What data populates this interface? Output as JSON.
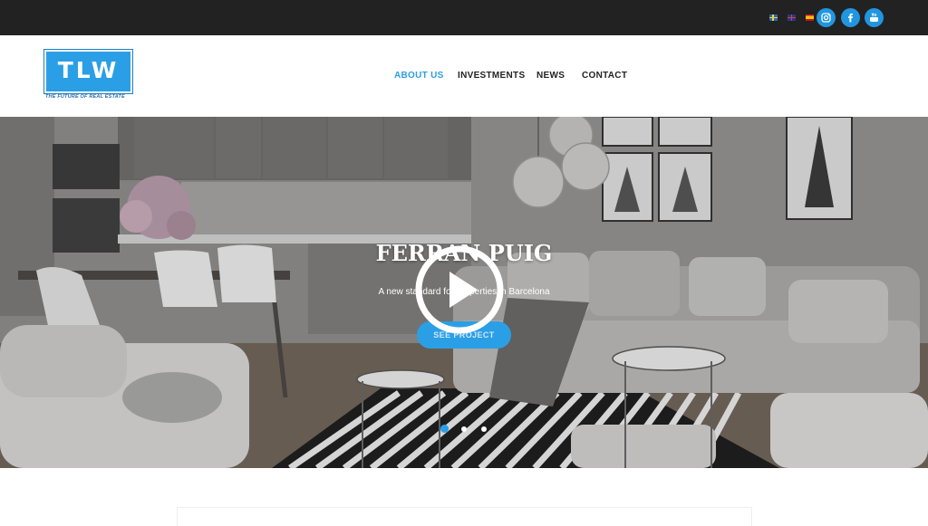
{
  "topbar": {
    "languages": [
      {
        "code": "se",
        "icon": "sweden-flag-icon"
      },
      {
        "code": "en",
        "icon": "uk-flag-icon"
      },
      {
        "code": "es",
        "icon": "spain-flag-icon"
      }
    ],
    "social": [
      "instagram-icon",
      "facebook-icon",
      "youtube-icon"
    ],
    "accent": "#2196e0"
  },
  "brand": {
    "logo_text": "TLW",
    "tagline": "THE FUTURE OF REAL ESTATE",
    "color": "#2b9fe6"
  },
  "nav": {
    "items": [
      {
        "label": "ABOUT US",
        "active": true
      },
      {
        "label": "INVESTMENTS",
        "active": false
      },
      {
        "label": "NEWS",
        "active": false
      },
      {
        "label": "CONTACT",
        "active": false
      }
    ]
  },
  "hero": {
    "title": "FERRAN PUIG",
    "subtitle": "A new standard for properties in Barcelona",
    "button": "SEE PROJECT",
    "slides": 3,
    "active_slide": 1
  }
}
